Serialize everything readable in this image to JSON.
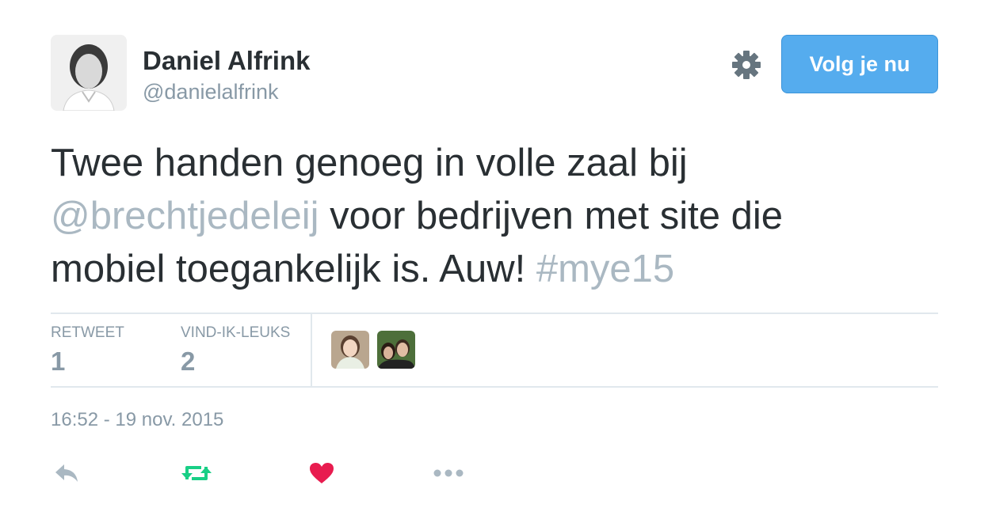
{
  "author": {
    "name": "Daniel Alfrink",
    "handle": "@danielalfrink"
  },
  "follow_button": {
    "label": "Volg je nu"
  },
  "tweet": {
    "line1": "Twee handen genoeg in volle zaal bij",
    "mention": "@brechtjedeleij",
    "line2_rest": " voor bedrijven met site die",
    "line3": "mobiel toegankelijk is. Auw! ",
    "hashtag": "#mye15"
  },
  "stats": {
    "retweet_label": "RETWEET",
    "retweet_count": "1",
    "likes_label": "VIND-IK-LEUKS",
    "likes_count": "2"
  },
  "timestamp": "16:52 - 19 nov. 2015",
  "colors": {
    "accent": "#55acee",
    "muted": "#8899a6",
    "link": "#aab8c2",
    "retweet_green": "#19cf86",
    "like_red": "#e81c4f"
  },
  "icons": [
    "settings-gear-icon",
    "reply-icon",
    "retweet-icon",
    "heart-icon",
    "more-icon"
  ]
}
